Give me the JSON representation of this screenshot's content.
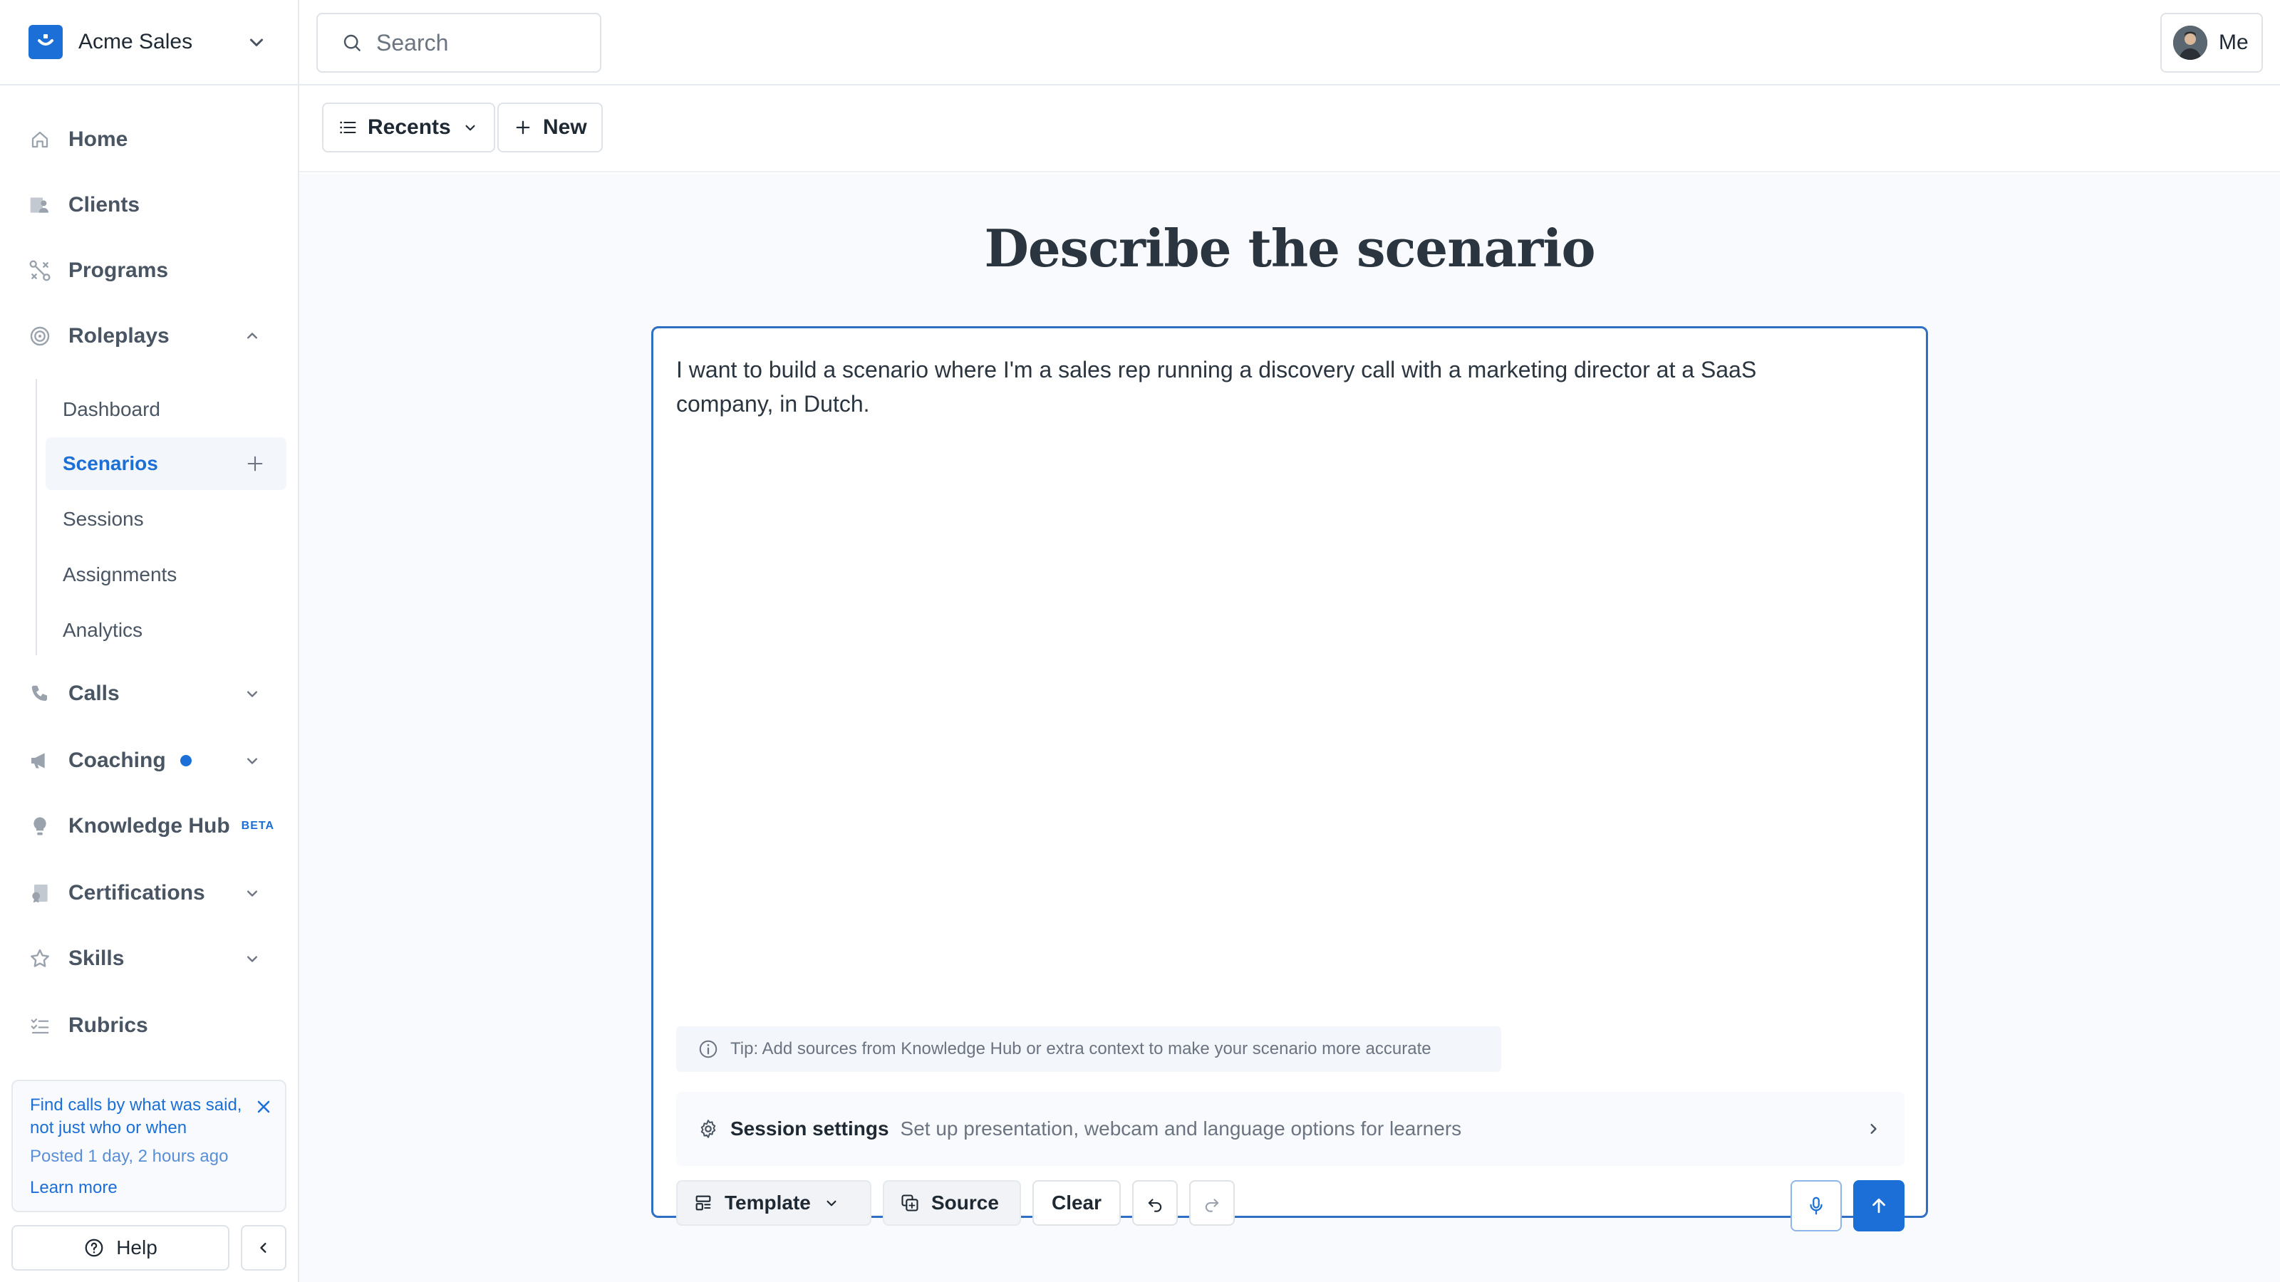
{
  "org": {
    "name": "Acme Sales",
    "logo_icon": "acme-logo-icon"
  },
  "nav": {
    "home": "Home",
    "clients": "Clients",
    "programs": "Programs",
    "roleplays": "Roleplays",
    "roleplays_sub": {
      "dashboard": "Dashboard",
      "scenarios": "Scenarios",
      "sessions": "Sessions",
      "assignments": "Assignments",
      "analytics": "Analytics"
    },
    "calls": "Calls",
    "coaching": "Coaching",
    "knowledge_hub": "Knowledge Hub",
    "knowledge_hub_badge": "BETA",
    "certifications": "Certifications",
    "skills": "Skills",
    "rubrics": "Rubrics",
    "active_item": "Scenarios"
  },
  "notice": {
    "title": "Find calls by what was said, not just who or when",
    "time": "Posted 1 day, 2 hours ago",
    "link": "Learn more"
  },
  "footer": {
    "help": "Help"
  },
  "topbar": {
    "search_placeholder": "Search",
    "user_label": "Me"
  },
  "toolbar": {
    "recents": "Recents",
    "new": "New"
  },
  "main": {
    "heading": "Describe the scenario",
    "prompt_text": "I want to build a scenario where I'm a sales rep running a discovery call with a marketing director at a SaaS company, in Dutch.",
    "tip": "Tip: Add sources from Knowledge Hub or extra context to make your scenario more accurate",
    "session_settings": {
      "title": "Session settings",
      "description": "Set up presentation, webcam and language options for learners"
    },
    "actions": {
      "template": "Template",
      "source": "Source",
      "clear": "Clear"
    }
  },
  "colors": {
    "accent": "#1b6fd6",
    "border": "#dfe3e8",
    "muted_text": "#6b7480",
    "background": "#f8fafd"
  }
}
